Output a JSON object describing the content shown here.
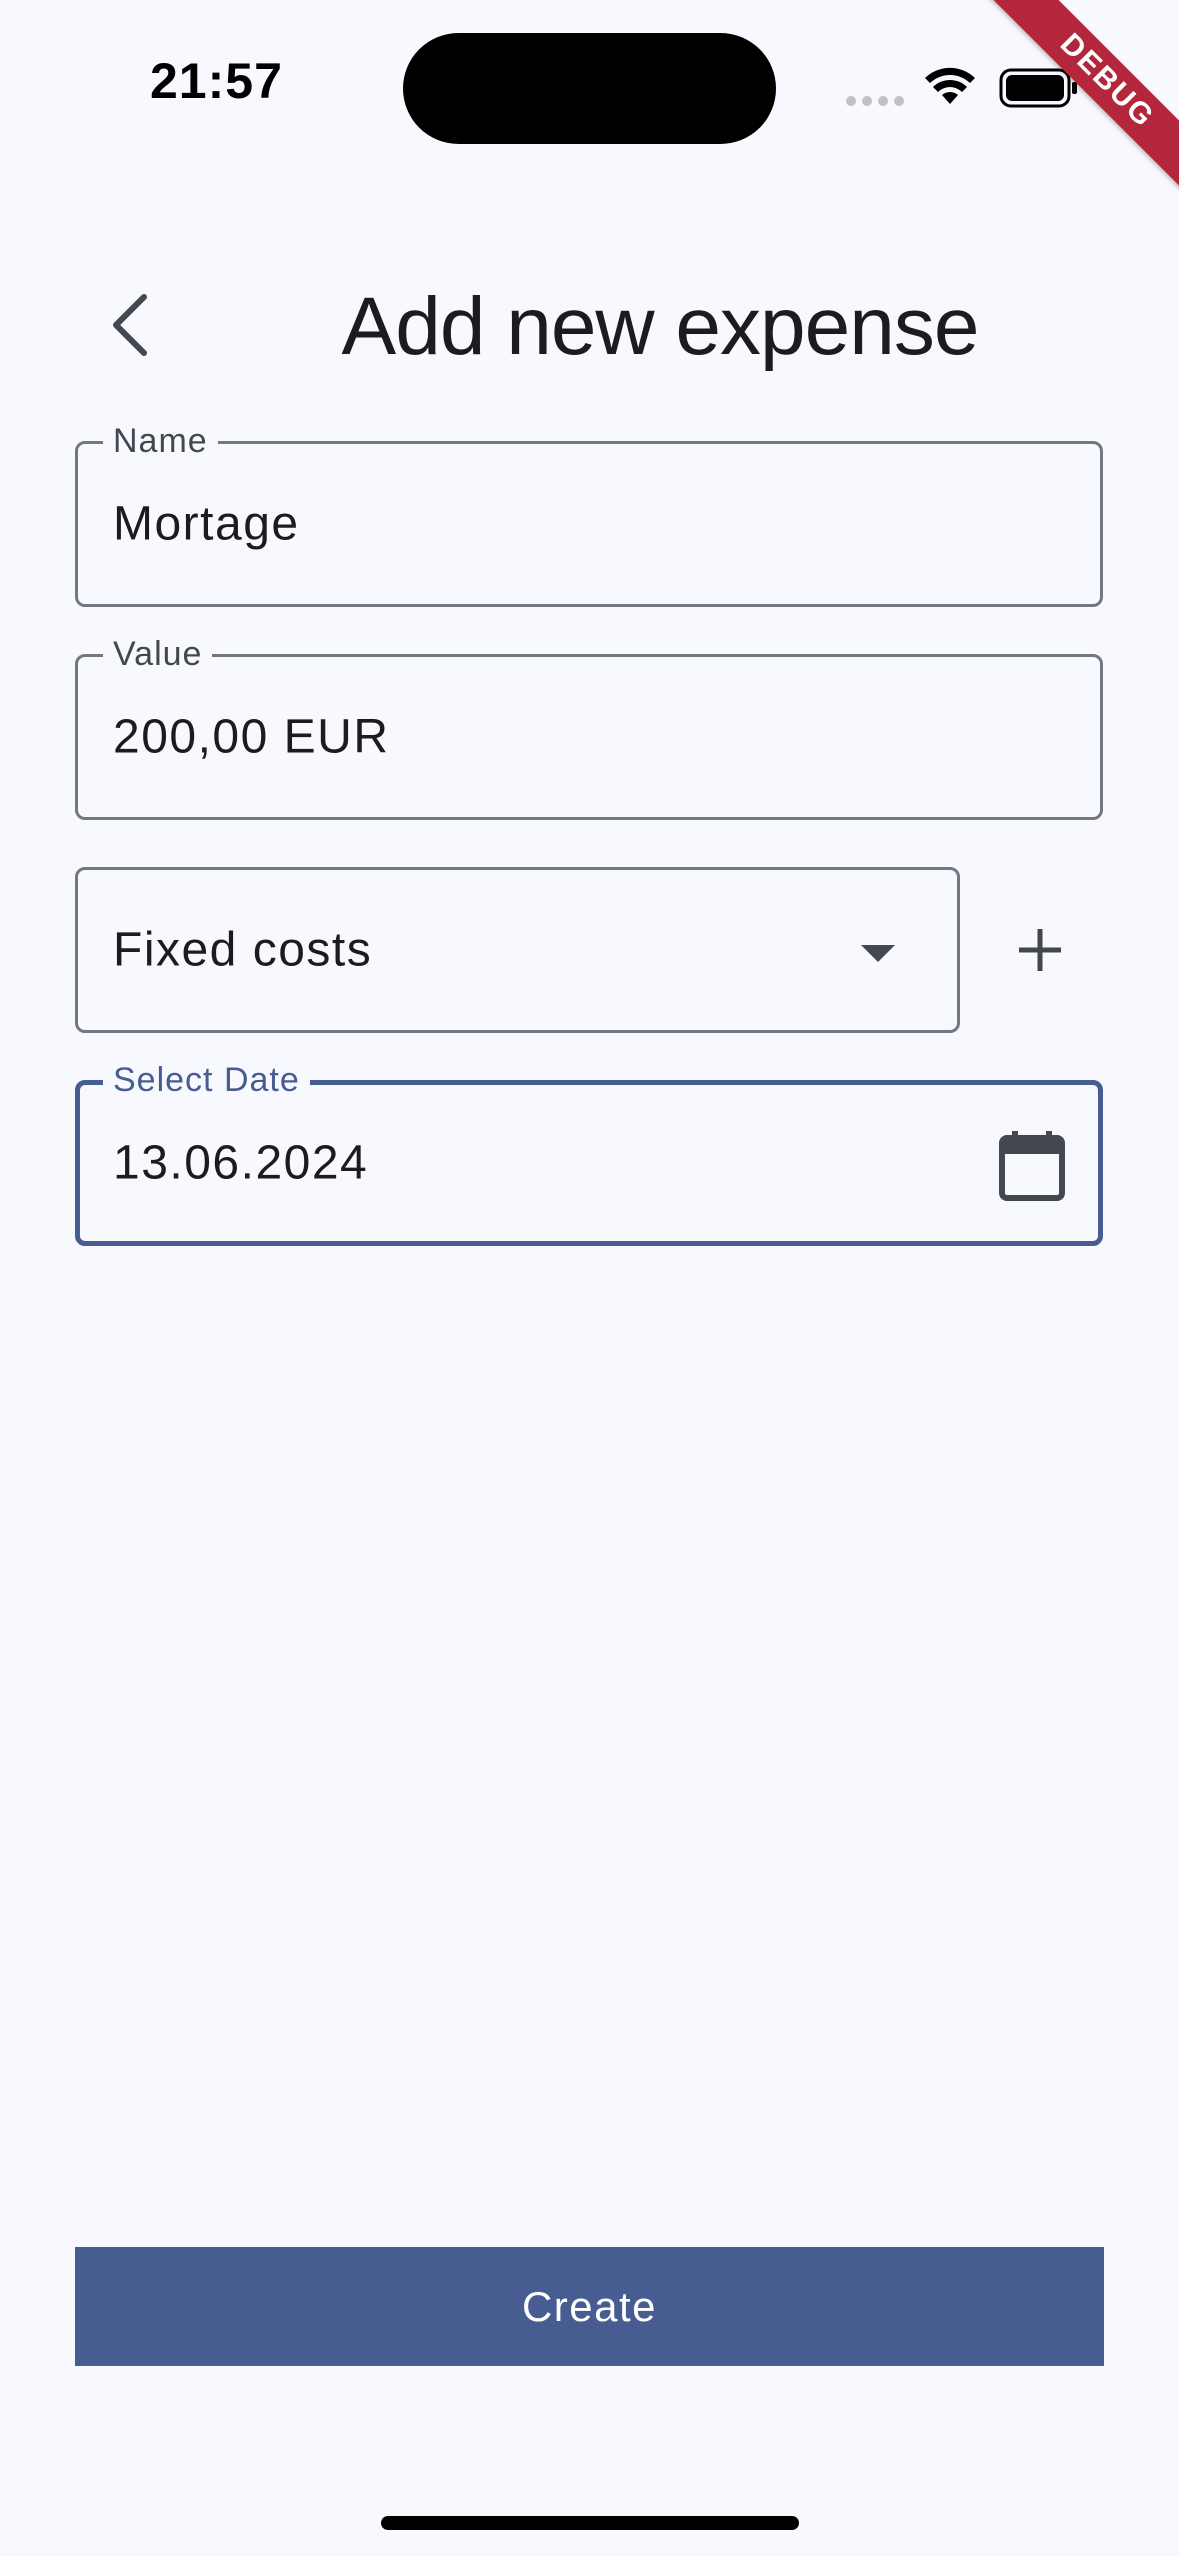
{
  "status_bar": {
    "time": "21:57",
    "icons": [
      "cellular-dots-icon",
      "wifi-icon",
      "battery-icon"
    ]
  },
  "debug_banner": "DEBUG",
  "app_bar": {
    "back_icon": "chevron-left-icon",
    "title": "Add new expense"
  },
  "form": {
    "name": {
      "label": "Name",
      "value": "Mortage"
    },
    "value": {
      "label": "Value",
      "value": "200,00 EUR"
    },
    "category": {
      "selected": "Fixed costs",
      "add_icon": "plus-icon"
    },
    "date": {
      "label": "Select Date",
      "value": "13.06.2024",
      "icon": "calendar-icon"
    }
  },
  "actions": {
    "create_label": "Create"
  },
  "colors": {
    "background": "#f8f9fe",
    "primary": "#475d92",
    "outline": "#74777f",
    "debug": "#b3263b"
  }
}
